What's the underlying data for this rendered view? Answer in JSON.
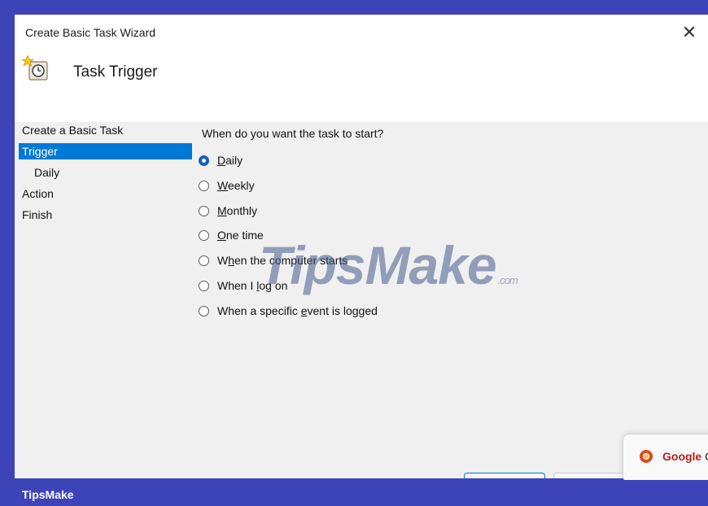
{
  "window": {
    "title": "Create Basic Task Wizard",
    "close_glyph": "✕"
  },
  "header": {
    "title": "Task Trigger",
    "icon": "scheduled-task-clock-icon"
  },
  "nav": {
    "items": [
      {
        "label": "Create a Basic Task"
      },
      {
        "label": "Trigger"
      },
      {
        "label": "Daily"
      },
      {
        "label": "Action"
      },
      {
        "label": "Finish"
      }
    ]
  },
  "content": {
    "question": "When do you want the task to start?",
    "options": [
      {
        "pre": "",
        "u": "D",
        "post": "aily",
        "checked": true
      },
      {
        "pre": "",
        "u": "W",
        "post": "eekly",
        "checked": false
      },
      {
        "pre": "",
        "u": "M",
        "post": "onthly",
        "checked": false
      },
      {
        "pre": "",
        "u": "O",
        "post": "ne time",
        "checked": false
      },
      {
        "pre": "W",
        "u": "h",
        "post": "en the computer starts",
        "checked": false
      },
      {
        "pre": "When I ",
        "u": "l",
        "post": "og on",
        "checked": false
      },
      {
        "pre": "When a specific ",
        "u": "e",
        "post": "vent is logged",
        "checked": false
      }
    ]
  },
  "watermark": {
    "text": "TipsMake",
    "suffix": ".com"
  },
  "toast": {
    "bold": "Google",
    "rest": " C"
  },
  "footer": {
    "brand": "TipsMake"
  },
  "colors": {
    "accent": "#0078d7",
    "frame": "#3c44b8",
    "radio_selected": "#1a5fb4"
  }
}
